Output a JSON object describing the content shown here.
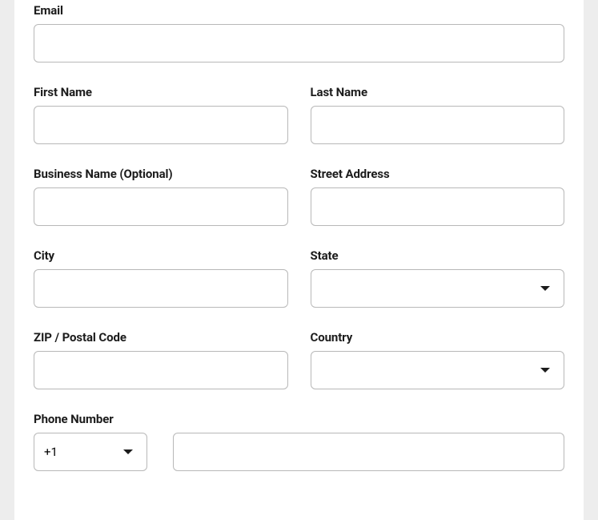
{
  "form": {
    "email": {
      "label": "Email",
      "value": ""
    },
    "first_name": {
      "label": "First Name",
      "value": ""
    },
    "last_name": {
      "label": "Last Name",
      "value": ""
    },
    "business_name": {
      "label": "Business Name (Optional)",
      "value": ""
    },
    "street_address": {
      "label": "Street Address",
      "value": ""
    },
    "city": {
      "label": "City",
      "value": ""
    },
    "state": {
      "label": "State",
      "value": ""
    },
    "zip": {
      "label": "ZIP / Postal Code",
      "value": ""
    },
    "country": {
      "label": "Country",
      "value": ""
    },
    "phone": {
      "label": "Phone Number",
      "code": "+1",
      "number": ""
    }
  }
}
